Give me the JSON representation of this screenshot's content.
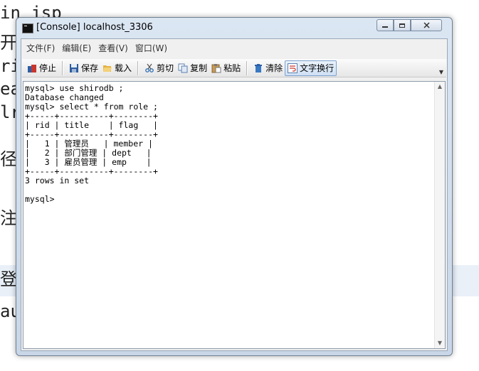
{
  "background": {
    "lines": [
      "in jsp",
      "开始",
      "ri",
      "ea",
      "lr",
      "径",
      "注",
      "登",
      "au"
    ]
  },
  "window": {
    "title": "[Console] localhost_3306",
    "menu": [
      "文件(F)",
      "编辑(E)",
      "查看(V)",
      "窗口(W)"
    ],
    "toolbar": {
      "stop": "停止",
      "save": "保存",
      "load": "载入",
      "cut": "剪切",
      "copy": "复制",
      "paste": "粘贴",
      "clear": "清除",
      "wrap": "文字换行"
    },
    "console_output": "mysql> use shirodb ;\nDatabase changed\nmysql> select * from role ;\n+-----+----------+--------+\n| rid | title    | flag   |\n+-----+----------+--------+\n|   1 | 管理员   | member |\n|   2 | 部门管理 | dept   |\n|   3 | 雇员管理 | emp    |\n+-----+----------+--------+\n3 rows in set\n\nmysql>"
  },
  "colors": {
    "title_bar": "#dbe6f3",
    "console_bg": "#ffffff",
    "active_button": "#cfe0f4"
  }
}
